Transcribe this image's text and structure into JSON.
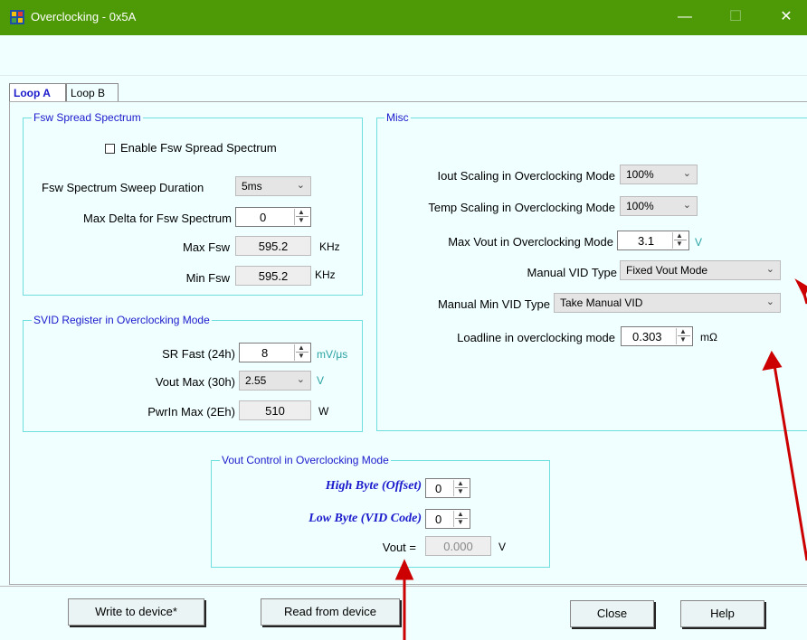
{
  "window": {
    "title": "Overclocking - 0x5A",
    "minimize": "—",
    "maximize": "☐",
    "close": "✕"
  },
  "tabs": [
    {
      "label": "Loop A"
    },
    {
      "label": "Loop B"
    }
  ],
  "fsw": {
    "title": "Fsw Spread Spectrum",
    "enable_label": "Enable Fsw Spread Spectrum",
    "sweep_label": "Fsw Spectrum Sweep Duration",
    "sweep_value": "5ms",
    "max_delta_label": "Max Delta for Fsw Spectrum",
    "max_delta_value": "0",
    "max_fsw_label": "Max Fsw",
    "max_fsw_value": "595.2",
    "min_fsw_label": "Min Fsw",
    "min_fsw_value": "595.2",
    "unit": "KHz"
  },
  "svid": {
    "title": "SVID Register in Overclocking Mode",
    "sr_fast_label": "SR Fast (24h)",
    "sr_fast_value": "8",
    "sr_fast_unit": "mV/μs",
    "vout_max_label": "Vout Max (30h)",
    "vout_max_value": "2.55",
    "vout_max_unit": "V",
    "pwrin_label": "PwrIn Max (2Eh)",
    "pwrin_value": "510",
    "pwrin_unit": "W"
  },
  "misc": {
    "title": "Misc",
    "iout_label": "Iout Scaling in Overclocking Mode",
    "iout_value": "100%",
    "temp_label": "Temp Scaling in Overclocking Mode",
    "temp_value": "100%",
    "maxvout_label": "Max Vout in Overclocking Mode",
    "maxvout_value": "3.1",
    "maxvout_unit": "V",
    "vidtype_label": "Manual VID Type",
    "vidtype_value": "Fixed Vout Mode",
    "minvid_label": "Manual Min VID Type",
    "minvid_value": "Take Manual VID",
    "loadline_label": "Loadline in overclocking mode",
    "loadline_value": "0.303",
    "loadline_unit": "mΩ"
  },
  "voutctl": {
    "title": "Vout Control in Overclocking Mode",
    "high_label": "High Byte (Offset)",
    "high_value": "0",
    "low_label": "Low Byte (VID Code)",
    "low_value": "0",
    "vout_label": "Vout =",
    "vout_value": "0.000",
    "vout_unit": "V"
  },
  "buttons": {
    "write": "Write to device*",
    "read": "Read from device",
    "close": "Close",
    "help": "Help"
  },
  "colors": {
    "titlebar": "#4e9a06",
    "group_border": "#6fdede",
    "accent_blue": "#1a1acc",
    "arrow_red": "#cc0000"
  }
}
